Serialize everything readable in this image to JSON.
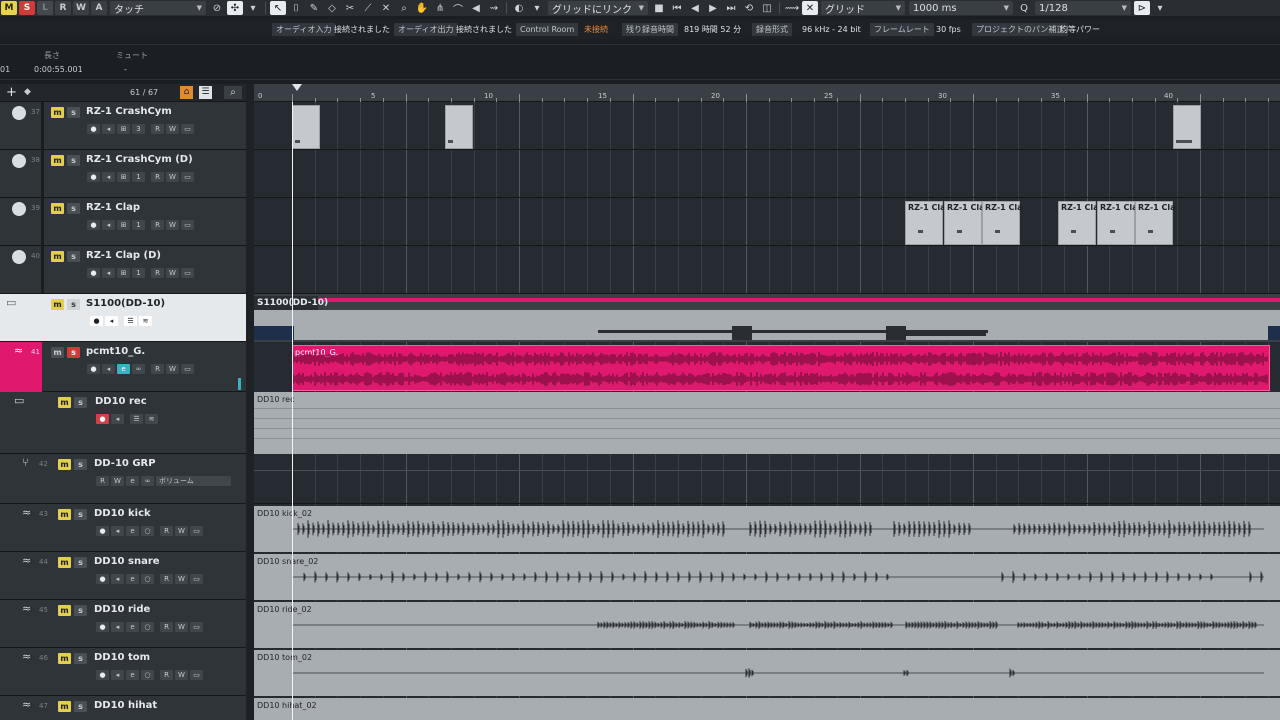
{
  "toolbar": {
    "mode_buttons": [
      "M",
      "S",
      "L",
      "R",
      "W",
      "A"
    ],
    "automation_mode": "タッチ",
    "snap_type": "グリッドにリンク",
    "grid_type": "グリッド",
    "nudge_value": "1000 ms",
    "quantize_label": "Q",
    "quantize_value": "1/128"
  },
  "statusbar": {
    "audio_in_label": "オーディオ入力",
    "audio_in_value": "接続されました",
    "audio_out_label": "オーディオ出力",
    "audio_out_value": "接続されました",
    "control_room_label": "Control Room",
    "control_room_value": "未接続",
    "rec_time_label": "残り録音時間",
    "rec_time_value": "819 時間 52 分",
    "rec_format_label": "録音形式",
    "rec_format_value": "96 kHz - 24 bit",
    "framerate_label": "フレームレート",
    "framerate_value": "30 fps",
    "pan_label": "プロジェクトのパン補正",
    "pan_value": "均等パワー"
  },
  "infoline": {
    "length_label": "長さ",
    "length_value": "0:00:55.001",
    "mute_label": "ミュート",
    "mute_value": "-",
    "left_value": "01"
  },
  "tracklist": {
    "count": "61 / 67"
  },
  "ruler": {
    "labels": [
      "0",
      "5",
      "10",
      "15",
      "20",
      "25",
      "30",
      "35",
      "40"
    ]
  },
  "tracks": [
    {
      "num": "37",
      "name": "RZ-1 CrashCym",
      "type": "instrument",
      "ctrl_value": "3"
    },
    {
      "num": "38",
      "name": "RZ-1 CrashCym (D)",
      "type": "instrument",
      "ctrl_value": "1"
    },
    {
      "num": "39",
      "name": "RZ-1 Clap",
      "type": "instrument",
      "ctrl_value": "1"
    },
    {
      "num": "40",
      "name": "RZ-1 Clap (D)",
      "type": "instrument",
      "ctrl_value": "1"
    },
    {
      "num": "",
      "name": "S1100(DD-10)",
      "type": "folder"
    },
    {
      "num": "41",
      "name": "pcmt10_G.",
      "type": "audio"
    },
    {
      "num": "",
      "name": "DD10 rec",
      "type": "folder"
    },
    {
      "num": "42",
      "name": "DD-10 GRP",
      "type": "group",
      "volume_label": "ボリューム"
    },
    {
      "num": "43",
      "name": "DD10 kick",
      "type": "audio"
    },
    {
      "num": "44",
      "name": "DD10 snare",
      "type": "audio"
    },
    {
      "num": "45",
      "name": "DD10 ride",
      "type": "audio"
    },
    {
      "num": "46",
      "name": "DD10 tom",
      "type": "audio"
    },
    {
      "num": "47",
      "name": "DD10 hihat",
      "type": "audio"
    }
  ],
  "events": {
    "clap_name": "RZ-1 Cla",
    "folder_part": "S1100(DD-10)",
    "pcm_part": "pcmt10_G.",
    "dd10rec_part": "DD10 rec",
    "kick_part": "DD10 kick_02",
    "snare_part": "DD10 snare_02",
    "ride_part": "DD10 ride_02",
    "tom_part": "DD10 tom_02",
    "hihat_part": "DD10 hihat_02"
  },
  "colors": {
    "mute_yellow": "#e2cf4c",
    "solo_red": "#d23a3a",
    "audio_pink": "#e0186e",
    "event_grey": "#c5c9cd",
    "warning_orange": "#f08a3a"
  }
}
